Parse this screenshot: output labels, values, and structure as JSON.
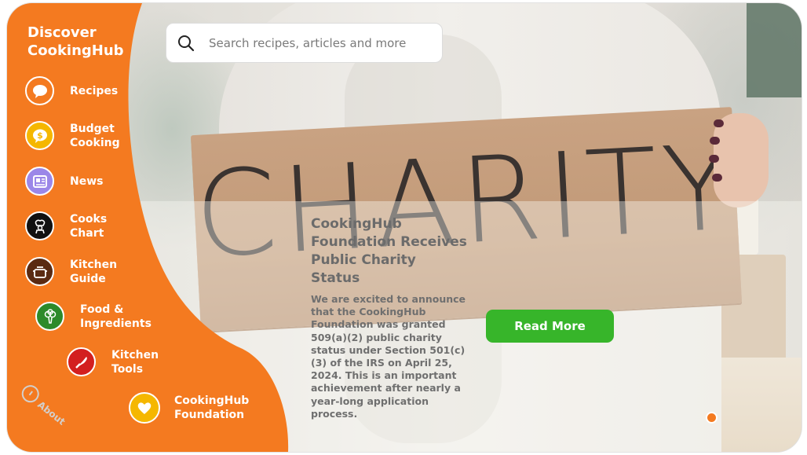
{
  "sidebar": {
    "title": "Discover CookingHub",
    "items": [
      {
        "label": "Recipes",
        "icon": "chat-bubbles-icon",
        "icon_bg": "#f47a20"
      },
      {
        "label": "Budget Cooking",
        "icon": "dollar-bubble-icon",
        "icon_bg": "#f5b700"
      },
      {
        "label": "News",
        "icon": "newspaper-icon",
        "icon_bg": "#9b87e8"
      },
      {
        "label": "Cooks Chart",
        "icon": "chef-icon",
        "icon_bg": "#111111"
      },
      {
        "label": "Kitchen Guide",
        "icon": "pot-icon",
        "icon_bg": "#5a2a12"
      },
      {
        "label": "Food & Ingredients",
        "icon": "broccoli-icon",
        "icon_bg": "#2d8a2a"
      },
      {
        "label": "Kitchen Tools",
        "icon": "knife-icon",
        "icon_bg": "#d31f1f"
      },
      {
        "label": "CookingHub Foundation",
        "icon": "heart-icon",
        "icon_bg": "#f5b700"
      }
    ],
    "about_label": "About",
    "accent": "#f47a20"
  },
  "search": {
    "placeholder": "Search recipes, articles and more"
  },
  "hero": {
    "sign_text": "CHARITY"
  },
  "article": {
    "title": "CookingHub Foundation Receives Public Charity Status",
    "body": "We are excited to announce that the CookingHub Foundation was granted 509(a)(2) public charity status under Section 501(c)(3) of the IRS on April 25, 2024. This is an important achievement after nearly a year-long application process.",
    "cta_label": "Read More",
    "cta_color": "#37b52a"
  },
  "carousel": {
    "active_index": 1,
    "dot_color": "#f47a20"
  }
}
